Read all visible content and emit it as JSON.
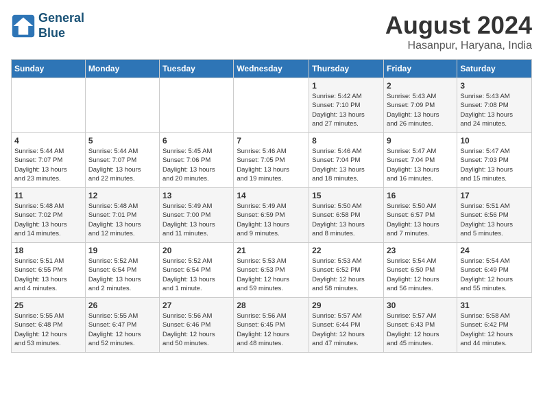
{
  "header": {
    "logo_line1": "General",
    "logo_line2": "Blue",
    "month_title": "August 2024",
    "subtitle": "Hasanpur, Haryana, India"
  },
  "columns": [
    "Sunday",
    "Monday",
    "Tuesday",
    "Wednesday",
    "Thursday",
    "Friday",
    "Saturday"
  ],
  "weeks": [
    [
      {
        "day": "",
        "info": ""
      },
      {
        "day": "",
        "info": ""
      },
      {
        "day": "",
        "info": ""
      },
      {
        "day": "",
        "info": ""
      },
      {
        "day": "1",
        "info": "Sunrise: 5:42 AM\nSunset: 7:10 PM\nDaylight: 13 hours\nand 27 minutes."
      },
      {
        "day": "2",
        "info": "Sunrise: 5:43 AM\nSunset: 7:09 PM\nDaylight: 13 hours\nand 26 minutes."
      },
      {
        "day": "3",
        "info": "Sunrise: 5:43 AM\nSunset: 7:08 PM\nDaylight: 13 hours\nand 24 minutes."
      }
    ],
    [
      {
        "day": "4",
        "info": "Sunrise: 5:44 AM\nSunset: 7:07 PM\nDaylight: 13 hours\nand 23 minutes."
      },
      {
        "day": "5",
        "info": "Sunrise: 5:44 AM\nSunset: 7:07 PM\nDaylight: 13 hours\nand 22 minutes."
      },
      {
        "day": "6",
        "info": "Sunrise: 5:45 AM\nSunset: 7:06 PM\nDaylight: 13 hours\nand 20 minutes."
      },
      {
        "day": "7",
        "info": "Sunrise: 5:46 AM\nSunset: 7:05 PM\nDaylight: 13 hours\nand 19 minutes."
      },
      {
        "day": "8",
        "info": "Sunrise: 5:46 AM\nSunset: 7:04 PM\nDaylight: 13 hours\nand 18 minutes."
      },
      {
        "day": "9",
        "info": "Sunrise: 5:47 AM\nSunset: 7:04 PM\nDaylight: 13 hours\nand 16 minutes."
      },
      {
        "day": "10",
        "info": "Sunrise: 5:47 AM\nSunset: 7:03 PM\nDaylight: 13 hours\nand 15 minutes."
      }
    ],
    [
      {
        "day": "11",
        "info": "Sunrise: 5:48 AM\nSunset: 7:02 PM\nDaylight: 13 hours\nand 14 minutes."
      },
      {
        "day": "12",
        "info": "Sunrise: 5:48 AM\nSunset: 7:01 PM\nDaylight: 13 hours\nand 12 minutes."
      },
      {
        "day": "13",
        "info": "Sunrise: 5:49 AM\nSunset: 7:00 PM\nDaylight: 13 hours\nand 11 minutes."
      },
      {
        "day": "14",
        "info": "Sunrise: 5:49 AM\nSunset: 6:59 PM\nDaylight: 13 hours\nand 9 minutes."
      },
      {
        "day": "15",
        "info": "Sunrise: 5:50 AM\nSunset: 6:58 PM\nDaylight: 13 hours\nand 8 minutes."
      },
      {
        "day": "16",
        "info": "Sunrise: 5:50 AM\nSunset: 6:57 PM\nDaylight: 13 hours\nand 7 minutes."
      },
      {
        "day": "17",
        "info": "Sunrise: 5:51 AM\nSunset: 6:56 PM\nDaylight: 13 hours\nand 5 minutes."
      }
    ],
    [
      {
        "day": "18",
        "info": "Sunrise: 5:51 AM\nSunset: 6:55 PM\nDaylight: 13 hours\nand 4 minutes."
      },
      {
        "day": "19",
        "info": "Sunrise: 5:52 AM\nSunset: 6:54 PM\nDaylight: 13 hours\nand 2 minutes."
      },
      {
        "day": "20",
        "info": "Sunrise: 5:52 AM\nSunset: 6:54 PM\nDaylight: 13 hours\nand 1 minute."
      },
      {
        "day": "21",
        "info": "Sunrise: 5:53 AM\nSunset: 6:53 PM\nDaylight: 12 hours\nand 59 minutes."
      },
      {
        "day": "22",
        "info": "Sunrise: 5:53 AM\nSunset: 6:52 PM\nDaylight: 12 hours\nand 58 minutes."
      },
      {
        "day": "23",
        "info": "Sunrise: 5:54 AM\nSunset: 6:50 PM\nDaylight: 12 hours\nand 56 minutes."
      },
      {
        "day": "24",
        "info": "Sunrise: 5:54 AM\nSunset: 6:49 PM\nDaylight: 12 hours\nand 55 minutes."
      }
    ],
    [
      {
        "day": "25",
        "info": "Sunrise: 5:55 AM\nSunset: 6:48 PM\nDaylight: 12 hours\nand 53 minutes."
      },
      {
        "day": "26",
        "info": "Sunrise: 5:55 AM\nSunset: 6:47 PM\nDaylight: 12 hours\nand 52 minutes."
      },
      {
        "day": "27",
        "info": "Sunrise: 5:56 AM\nSunset: 6:46 PM\nDaylight: 12 hours\nand 50 minutes."
      },
      {
        "day": "28",
        "info": "Sunrise: 5:56 AM\nSunset: 6:45 PM\nDaylight: 12 hours\nand 48 minutes."
      },
      {
        "day": "29",
        "info": "Sunrise: 5:57 AM\nSunset: 6:44 PM\nDaylight: 12 hours\nand 47 minutes."
      },
      {
        "day": "30",
        "info": "Sunrise: 5:57 AM\nSunset: 6:43 PM\nDaylight: 12 hours\nand 45 minutes."
      },
      {
        "day": "31",
        "info": "Sunrise: 5:58 AM\nSunset: 6:42 PM\nDaylight: 12 hours\nand 44 minutes."
      }
    ]
  ]
}
